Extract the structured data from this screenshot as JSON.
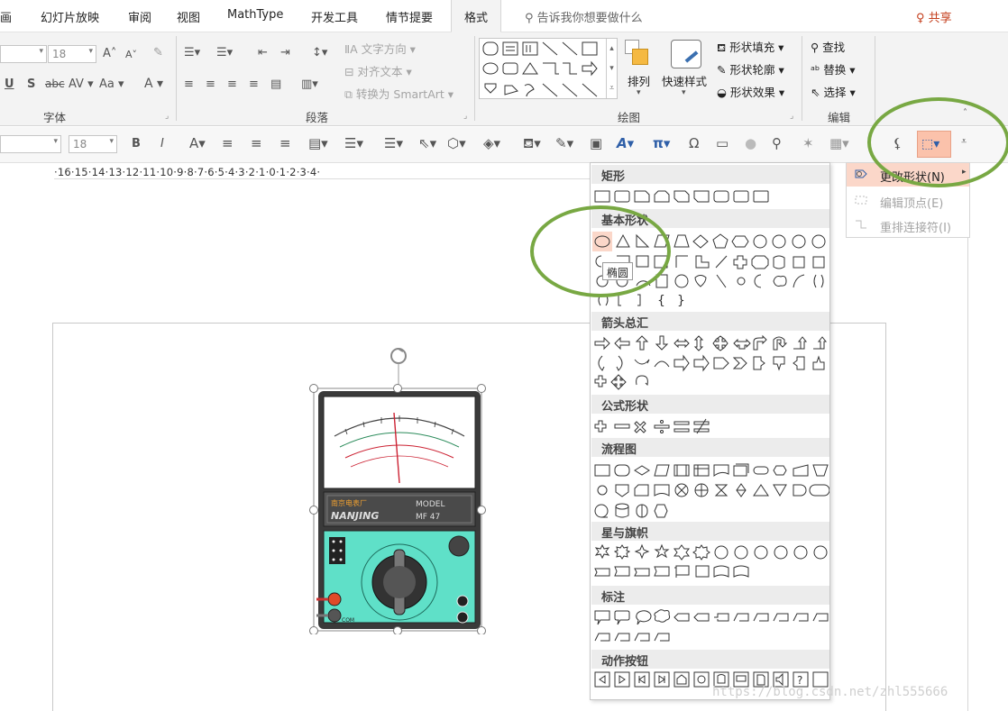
{
  "tabs": [
    {
      "label": "画"
    },
    {
      "label": "幻灯片放映"
    },
    {
      "label": "审阅"
    },
    {
      "label": "视图"
    },
    {
      "label": "MathType"
    },
    {
      "label": "开发工具"
    },
    {
      "label": "情节提要"
    },
    {
      "label": "格式"
    }
  ],
  "tell_me": "告诉我你想要做什么",
  "share": "共享",
  "font_group": {
    "label": "字体",
    "font_size": "18",
    "underline": "U",
    "shadow": "S",
    "strike": "abc",
    "spacing": "AV",
    "case": "Aa",
    "color": "A"
  },
  "paragraph_group": {
    "label": "段落",
    "text_direction": "文字方向",
    "align_text": "对齐文本",
    "convert_smartart": "转换为 SmartArt"
  },
  "drawing_group": {
    "label": "绘图",
    "arrange": "排列",
    "quick_styles": "快速样式",
    "shape_fill": "形状填充",
    "shape_outline": "形状轮廓",
    "shape_effects": "形状效果"
  },
  "editing_group": {
    "label": "编辑",
    "find": "查找",
    "replace": "替换",
    "select": "选择"
  },
  "toolbar2": {
    "font_size": "18",
    "bold": "B",
    "italic": "I",
    "font_color": "A",
    "pi": "π",
    "omega": "Ω"
  },
  "ruler": "·16·15·14·13·12·11·10·9·8·7·6·5·4·3·2·1·0·1·2·3·4·",
  "shape_menu": {
    "sections": [
      {
        "title": "矩形"
      },
      {
        "title": "基本形状"
      },
      {
        "title": "箭头总汇"
      },
      {
        "title": "公式形状"
      },
      {
        "title": "流程图"
      },
      {
        "title": "星与旗帜"
      },
      {
        "title": "标注"
      },
      {
        "title": "动作按钮"
      }
    ],
    "tooltip": "椭圆"
  },
  "submenu": {
    "items": [
      {
        "label": "更改形状(N)",
        "state": "highlighted"
      },
      {
        "label": "编辑顶点(E)",
        "state": "disabled"
      },
      {
        "label": "重排连接符(I)",
        "state": "disabled"
      }
    ]
  },
  "multimeter": {
    "brand_cn": "南京电表厂",
    "brand": "NANJING",
    "model_label": "MODEL",
    "model": "MF 47",
    "com": "COM"
  },
  "watermark": "https://blog.csdn.net/zhl555666",
  "colors": {
    "accent": "#c43e1c",
    "highlight_ring": "#78a843",
    "meter_body": "#3a3a3a",
    "meter_panel": "#5fe0c8",
    "submenu_highlight": "#fbd7c9"
  }
}
